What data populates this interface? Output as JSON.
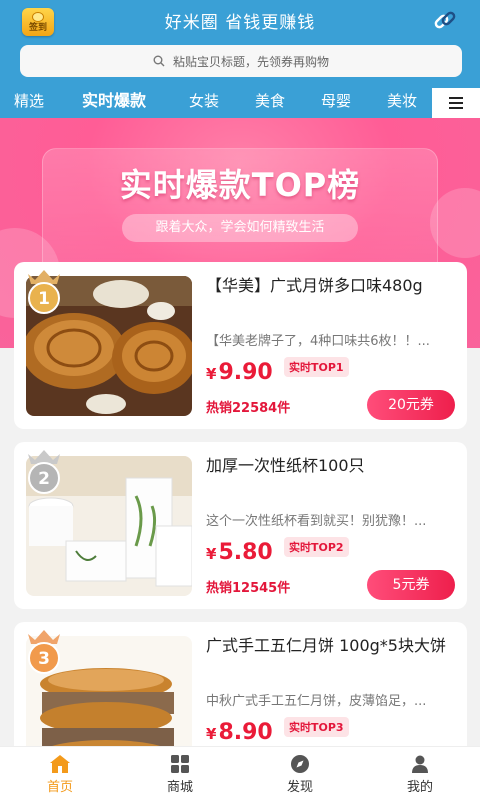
{
  "header": {
    "sign_label": "签到",
    "title": "好米圈 省钱更赚钱",
    "search_placeholder": "粘贴宝贝标题，先领券再购物"
  },
  "tabs": [
    {
      "label": "精选"
    },
    {
      "label": "实时爆款"
    },
    {
      "label": "女装"
    },
    {
      "label": "美食"
    },
    {
      "label": "母婴"
    },
    {
      "label": "美妆"
    }
  ],
  "banner": {
    "title": "实时爆款TOP榜",
    "subtitle": "跟着大众，学会如何精致生活"
  },
  "products": [
    {
      "rank": "1",
      "name": "【华美】广式月饼多口味480g",
      "desc": "【华美老牌子了，4种口味共6枚！！...",
      "yen": "¥",
      "price": "9.90",
      "tag": "实时TOP1",
      "sales": "热销22584件",
      "coupon": "20元券"
    },
    {
      "rank": "2",
      "name": "加厚一次性纸杯100只",
      "desc": "这个一次性纸杯看到就买！别犹豫！...",
      "yen": "¥",
      "price": "5.80",
      "tag": "实时TOP2",
      "sales": "热销12545件",
      "coupon": "5元券"
    },
    {
      "rank": "3",
      "name": "广式手工五仁月饼 100g*5块大饼",
      "desc": "中秋广式手工五仁月饼，皮薄馅足，...",
      "yen": "¥",
      "price": "8.90",
      "tag": "实时TOP3",
      "sales": "",
      "coupon": ""
    }
  ],
  "bottom_nav": [
    {
      "label": "首页",
      "icon": "home-icon"
    },
    {
      "label": "商城",
      "icon": "grid-icon"
    },
    {
      "label": "发现",
      "icon": "compass-icon"
    },
    {
      "label": "我的",
      "icon": "user-icon"
    }
  ],
  "colors": {
    "header_blue": "#3aa0d6",
    "banner_pink": "#ff5d96",
    "price_red": "#ea1b38",
    "active_orange": "#f39a1b"
  }
}
